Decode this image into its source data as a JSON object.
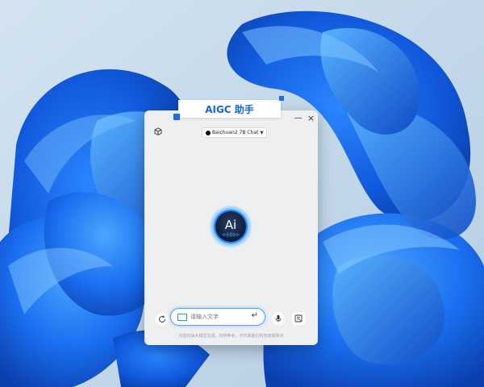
{
  "window": {
    "title": "AIGC 助手",
    "minimize_symbol": "—",
    "close_symbol": "×"
  },
  "toolbar": {
    "cube_icon": "cube-icon",
    "model_select": {
      "value": "Baichuan2 7B Chat"
    }
  },
  "center_logo": {
    "text": "Ai"
  },
  "input": {
    "placeholder": "请输入文字",
    "enter_icon": "enter-icon"
  },
  "actions": {
    "refresh_icon": "refresh-icon",
    "mic_icon": "microphone-icon",
    "file_icon": "document-icon"
  },
  "footer": {
    "disclaimer": "内容均由大模型生成，仅供参考，不代表我们的态度或观点"
  },
  "colors": {
    "accent": "#1e6be6",
    "panel_bg": "#eeeff1",
    "input_border": "#4aa3f2",
    "wallpaper_light": "#c4d8ea",
    "wallpaper_blue": "#1565e0"
  }
}
